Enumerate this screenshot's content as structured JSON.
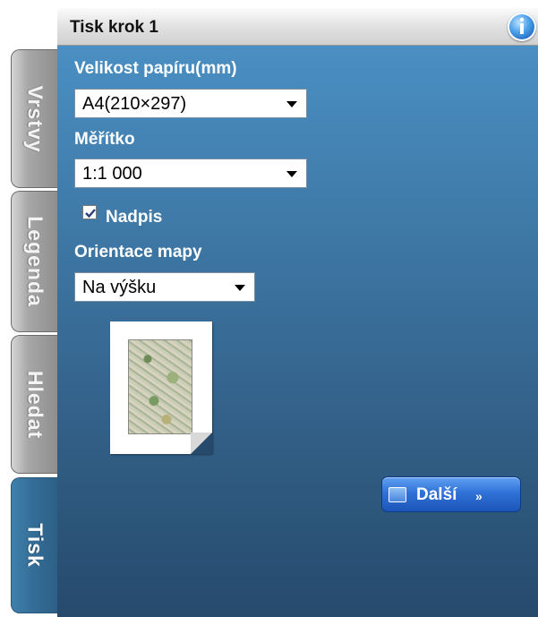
{
  "window": {
    "title": "Tisk krok 1"
  },
  "tabs": [
    {
      "label": "Vrstvy",
      "active": false
    },
    {
      "label": "Legenda",
      "active": false
    },
    {
      "label": "Hledat",
      "active": false
    },
    {
      "label": "Tisk",
      "active": true
    }
  ],
  "form": {
    "paper_size_label": "Velikost papíru(mm)",
    "paper_size_value": "A4(210×297)",
    "scale_label": "Měřítko",
    "scale_value": "1:1 000",
    "title_checkbox_label": "Nadpis",
    "title_checkbox_checked": true,
    "orientation_label": "Orientace mapy",
    "orientation_value": "Na výšku"
  },
  "actions": {
    "next_label": "Další",
    "next_chevron": "»"
  },
  "icons": {
    "info": "info-icon",
    "paper_preview": "page-preview-icon",
    "next_button_icon": "window-icon"
  },
  "colors": {
    "panel_top": "#4a8fc3",
    "panel_bottom": "#264a6c",
    "button_blue": "#2f72d8"
  }
}
